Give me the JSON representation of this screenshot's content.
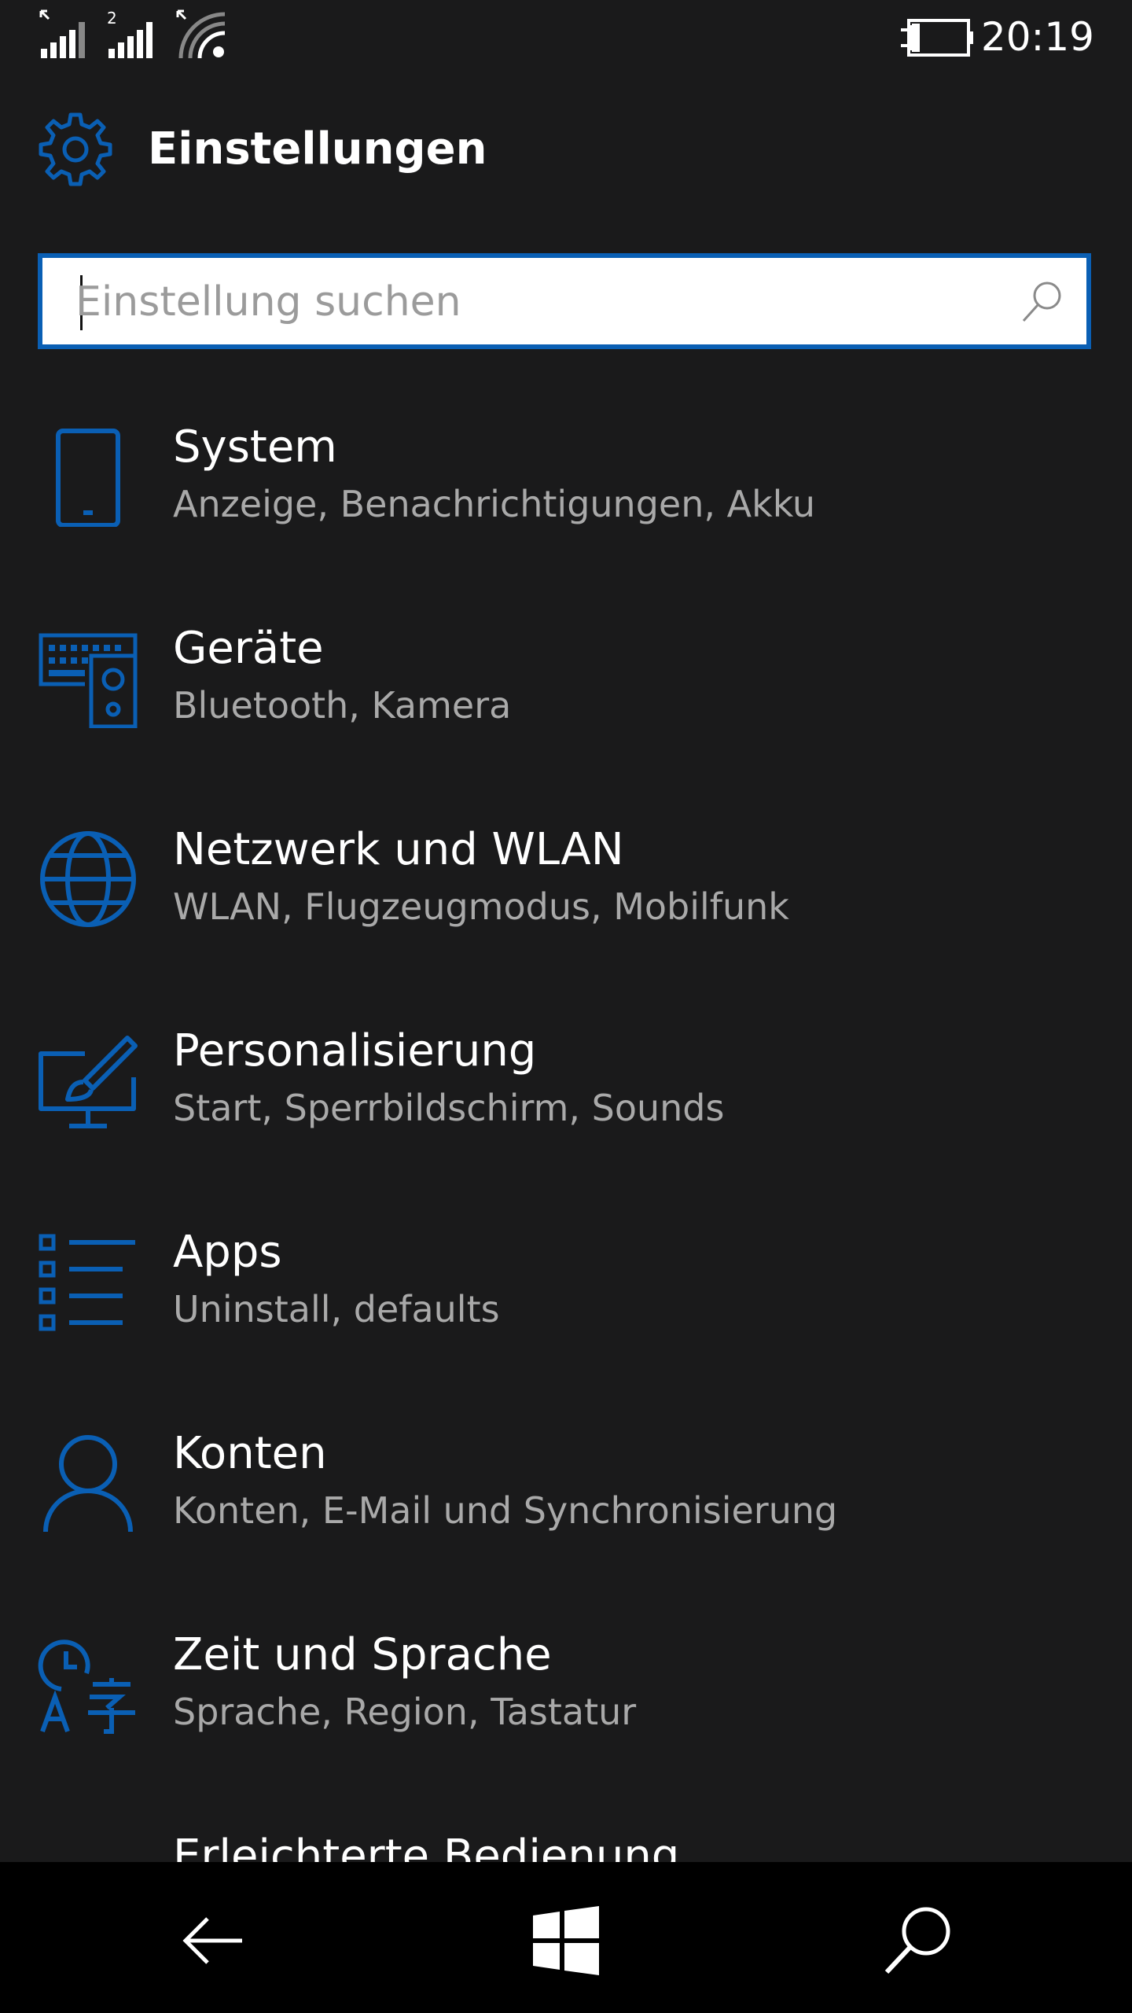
{
  "status": {
    "time": "20:19",
    "signal1_sup": "",
    "signal2_sup": "2"
  },
  "header": {
    "title": "Einstellungen",
    "icon": "gear-icon"
  },
  "search": {
    "placeholder": "Einstellung suchen",
    "value": ""
  },
  "items": [
    {
      "name": "System",
      "desc": "Anzeige, Benachrichtigungen, Akku",
      "icon": "phone-icon"
    },
    {
      "name": "Geräte",
      "desc": "Bluetooth, Kamera",
      "icon": "devices-icon"
    },
    {
      "name": "Netzwerk und WLAN",
      "desc": "WLAN, Flugzeugmodus, Mobilfunk",
      "icon": "globe-icon"
    },
    {
      "name": "Personalisierung",
      "desc": "Start, Sperrbildschirm, Sounds",
      "icon": "paint-icon"
    },
    {
      "name": "Apps",
      "desc": "Uninstall, defaults",
      "icon": "apps-list-icon"
    },
    {
      "name": "Konten",
      "desc": "Konten, E-Mail und Synchronisierung",
      "icon": "person-icon"
    },
    {
      "name": "Zeit und Sprache",
      "desc": "Sprache, Region, Tastatur",
      "icon": "time-language-icon"
    },
    {
      "name": "Erleichterte Bedienung",
      "desc": "",
      "icon": "ease-of-access-icon"
    }
  ],
  "navbar": {
    "back": "back-icon",
    "start": "windows-start-icon",
    "search": "search-icon"
  },
  "colors": {
    "accent": "#0a5fb4",
    "background": "#1a1a1b",
    "text": "#ffffff",
    "subtext": "#a9a9a9"
  }
}
